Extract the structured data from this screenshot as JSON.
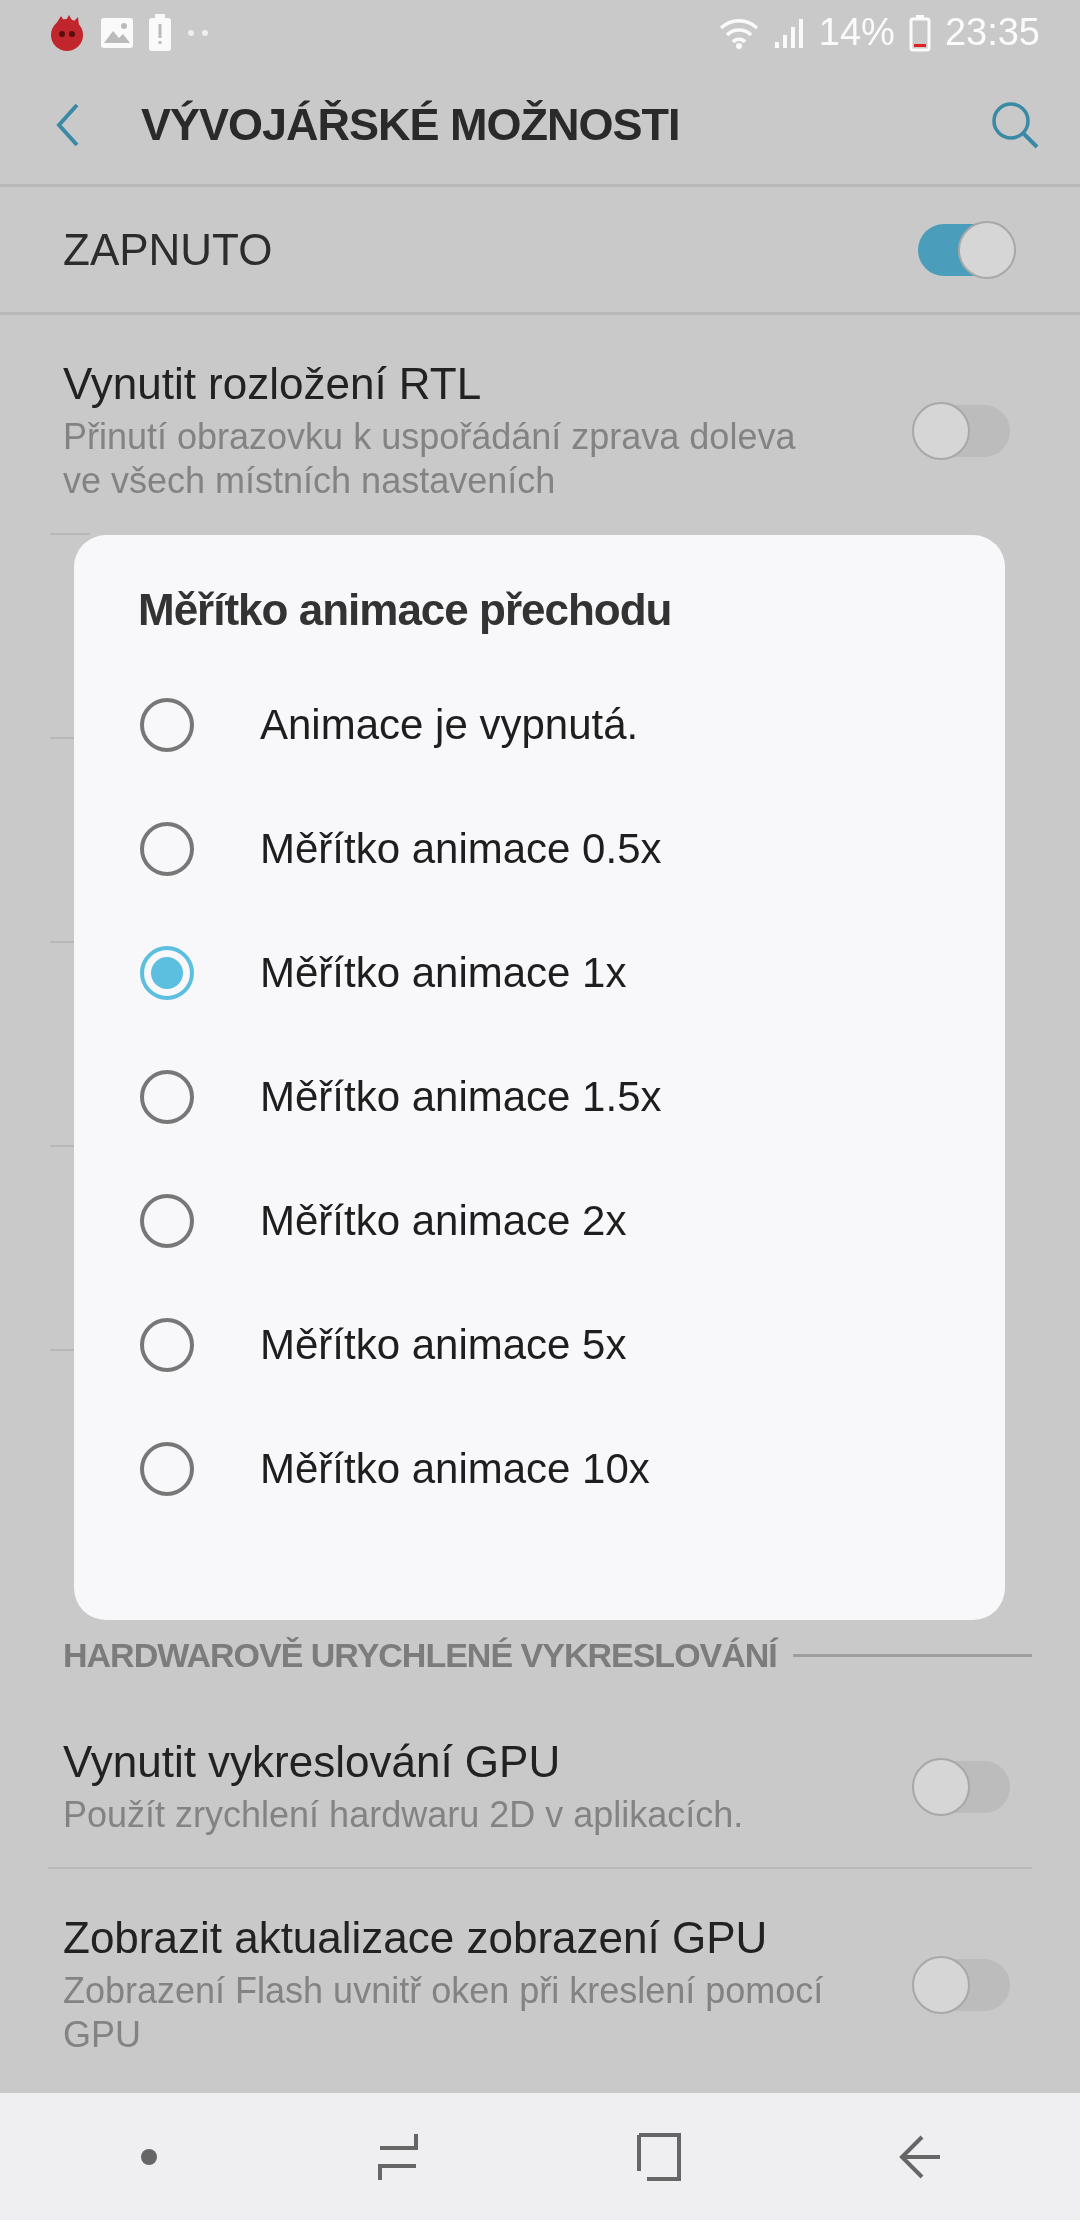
{
  "status_bar": {
    "battery": "14%",
    "time": "23:35"
  },
  "toolbar": {
    "title": "VÝVOJÁŘSKÉ MOŽNOSTI"
  },
  "master_switch": {
    "label": "ZAPNUTO",
    "on": true
  },
  "settings_top": [
    {
      "title": "Vynutit rozložení RTL",
      "subtitle": "Přinutí obrazovku k uspořádání zprava doleva ve všech místních nastaveních",
      "on": false
    }
  ],
  "dialog": {
    "title": "Měřítko animace přechodu",
    "options": [
      {
        "label": "Animace je vypnutá.",
        "selected": false
      },
      {
        "label": "Měřítko animace 0.5x",
        "selected": false
      },
      {
        "label": "Měřítko animace 1x",
        "selected": true
      },
      {
        "label": "Měřítko animace 1.5x",
        "selected": false
      },
      {
        "label": "Měřítko animace 2x",
        "selected": false
      },
      {
        "label": "Měřítko animace 5x",
        "selected": false
      },
      {
        "label": "Měřítko animace 10x",
        "selected": false
      }
    ]
  },
  "section": {
    "header": "HARDWAROVĚ URYCHLENÉ VYKRESLOVÁNÍ"
  },
  "settings_bottom": [
    {
      "title": "Vynutit vykreslování GPU",
      "subtitle": "Použít zrychlení hardwaru 2D v aplikacích.",
      "on": false
    },
    {
      "title": "Zobrazit aktualizace zobrazení GPU",
      "subtitle": "Zobrazení Flash uvnitř oken při kreslení pomocí GPU",
      "on": false
    }
  ]
}
